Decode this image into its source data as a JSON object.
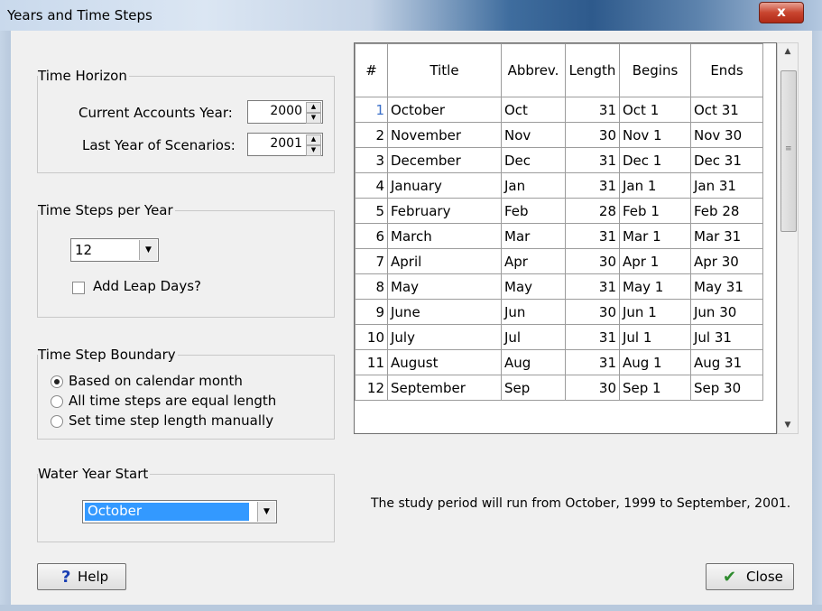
{
  "window": {
    "title": "Years and Time Steps",
    "close_glyph": "x"
  },
  "time_horizon": {
    "legend": "Time Horizon",
    "current_label": "Current Accounts Year:",
    "current_value": "2000",
    "last_label": "Last Year of Scenarios:",
    "last_value": "2001"
  },
  "time_steps": {
    "legend": "Time Steps per Year",
    "value": "12",
    "leap_label": "Add Leap Days?",
    "leap_checked": false
  },
  "boundary": {
    "legend": "Time Step Boundary",
    "options": [
      "Based on calendar month",
      "All time steps are equal length",
      "Set time step length manually"
    ],
    "selected_index": 0
  },
  "water_year": {
    "legend": "Water Year Start",
    "value": "October"
  },
  "table": {
    "headers": [
      "#",
      "Title",
      "Abbrev.",
      "Length",
      "Begins",
      "Ends"
    ],
    "rows": [
      [
        "1",
        "October",
        "Oct",
        "31",
        "Oct 1",
        "Oct 31"
      ],
      [
        "2",
        "November",
        "Nov",
        "30",
        "Nov 1",
        "Nov 30"
      ],
      [
        "3",
        "December",
        "Dec",
        "31",
        "Dec 1",
        "Dec 31"
      ],
      [
        "4",
        "January",
        "Jan",
        "31",
        "Jan 1",
        "Jan 31"
      ],
      [
        "5",
        "February",
        "Feb",
        "28",
        "Feb 1",
        "Feb 28"
      ],
      [
        "6",
        "March",
        "Mar",
        "31",
        "Mar 1",
        "Mar 31"
      ],
      [
        "7",
        "April",
        "Apr",
        "30",
        "Apr 1",
        "Apr 30"
      ],
      [
        "8",
        "May",
        "May",
        "31",
        "May 1",
        "May 31"
      ],
      [
        "9",
        "June",
        "Jun",
        "30",
        "Jun 1",
        "Jun 30"
      ],
      [
        "10",
        "July",
        "Jul",
        "31",
        "Jul 1",
        "Jul 31"
      ],
      [
        "11",
        "August",
        "Aug",
        "31",
        "Aug 1",
        "Aug 31"
      ],
      [
        "12",
        "September",
        "Sep",
        "30",
        "Sep 1",
        "Sep 30"
      ]
    ]
  },
  "study_text": "The study period will run from October, 1999 to September, 2001.",
  "buttons": {
    "help_label": "Help",
    "help_icon": "question-mark-icon",
    "close_label": "Close",
    "close_icon": "checkmark-icon"
  },
  "colors": {
    "help_icon": "#1a3fb3",
    "close_icon": "#2e8b2e",
    "selection": "#3399ff",
    "row_highlight": "#3a6fc9"
  }
}
